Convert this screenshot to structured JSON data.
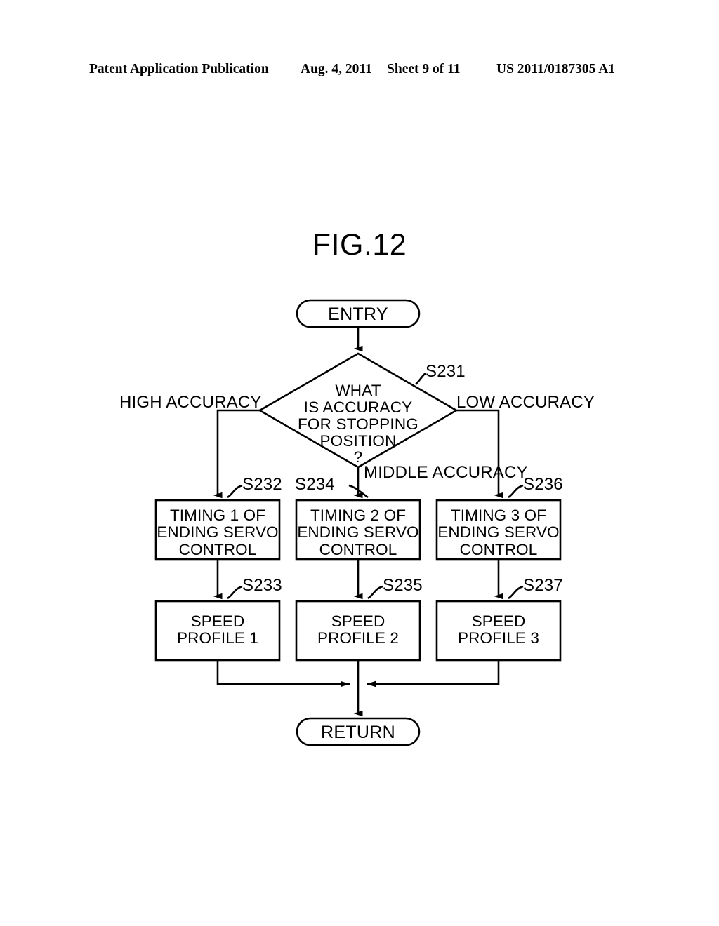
{
  "header": {
    "publication": "Patent Application Publication",
    "date": "Aug. 4, 2011",
    "sheet": "Sheet 9 of 11",
    "patent_number": "US 2011/0187305 A1"
  },
  "figure": {
    "title": "FIG.12"
  },
  "flowchart": {
    "entry": {
      "label": "ENTRY"
    },
    "decision": {
      "ref": "S231",
      "label": "WHAT\nIS ACCURACY\nFOR STOPPING\nPOSITION\n?"
    },
    "branches": {
      "left": "HIGH ACCURACY",
      "middle": "MIDDLE\nACCURACY",
      "right": "LOW ACCURACY"
    },
    "timing_boxes": [
      {
        "ref": "S232",
        "label": "TIMING 1 OF\nENDING SERVO\nCONTROL"
      },
      {
        "ref": "S234",
        "label": "TIMING 2 OF\nENDING SERVO\nCONTROL"
      },
      {
        "ref": "S236",
        "label": "TIMING 3 OF\nENDING SERVO\nCONTROL"
      }
    ],
    "profile_boxes": [
      {
        "ref": "S233",
        "label": "SPEED\nPROFILE 1"
      },
      {
        "ref": "S235",
        "label": "SPEED\nPROFILE 2"
      },
      {
        "ref": "S237",
        "label": "SPEED\nPROFILE 3"
      }
    ],
    "return": {
      "label": "RETURN"
    }
  },
  "colors": {
    "ink": "#000000",
    "paper": "#ffffff"
  }
}
